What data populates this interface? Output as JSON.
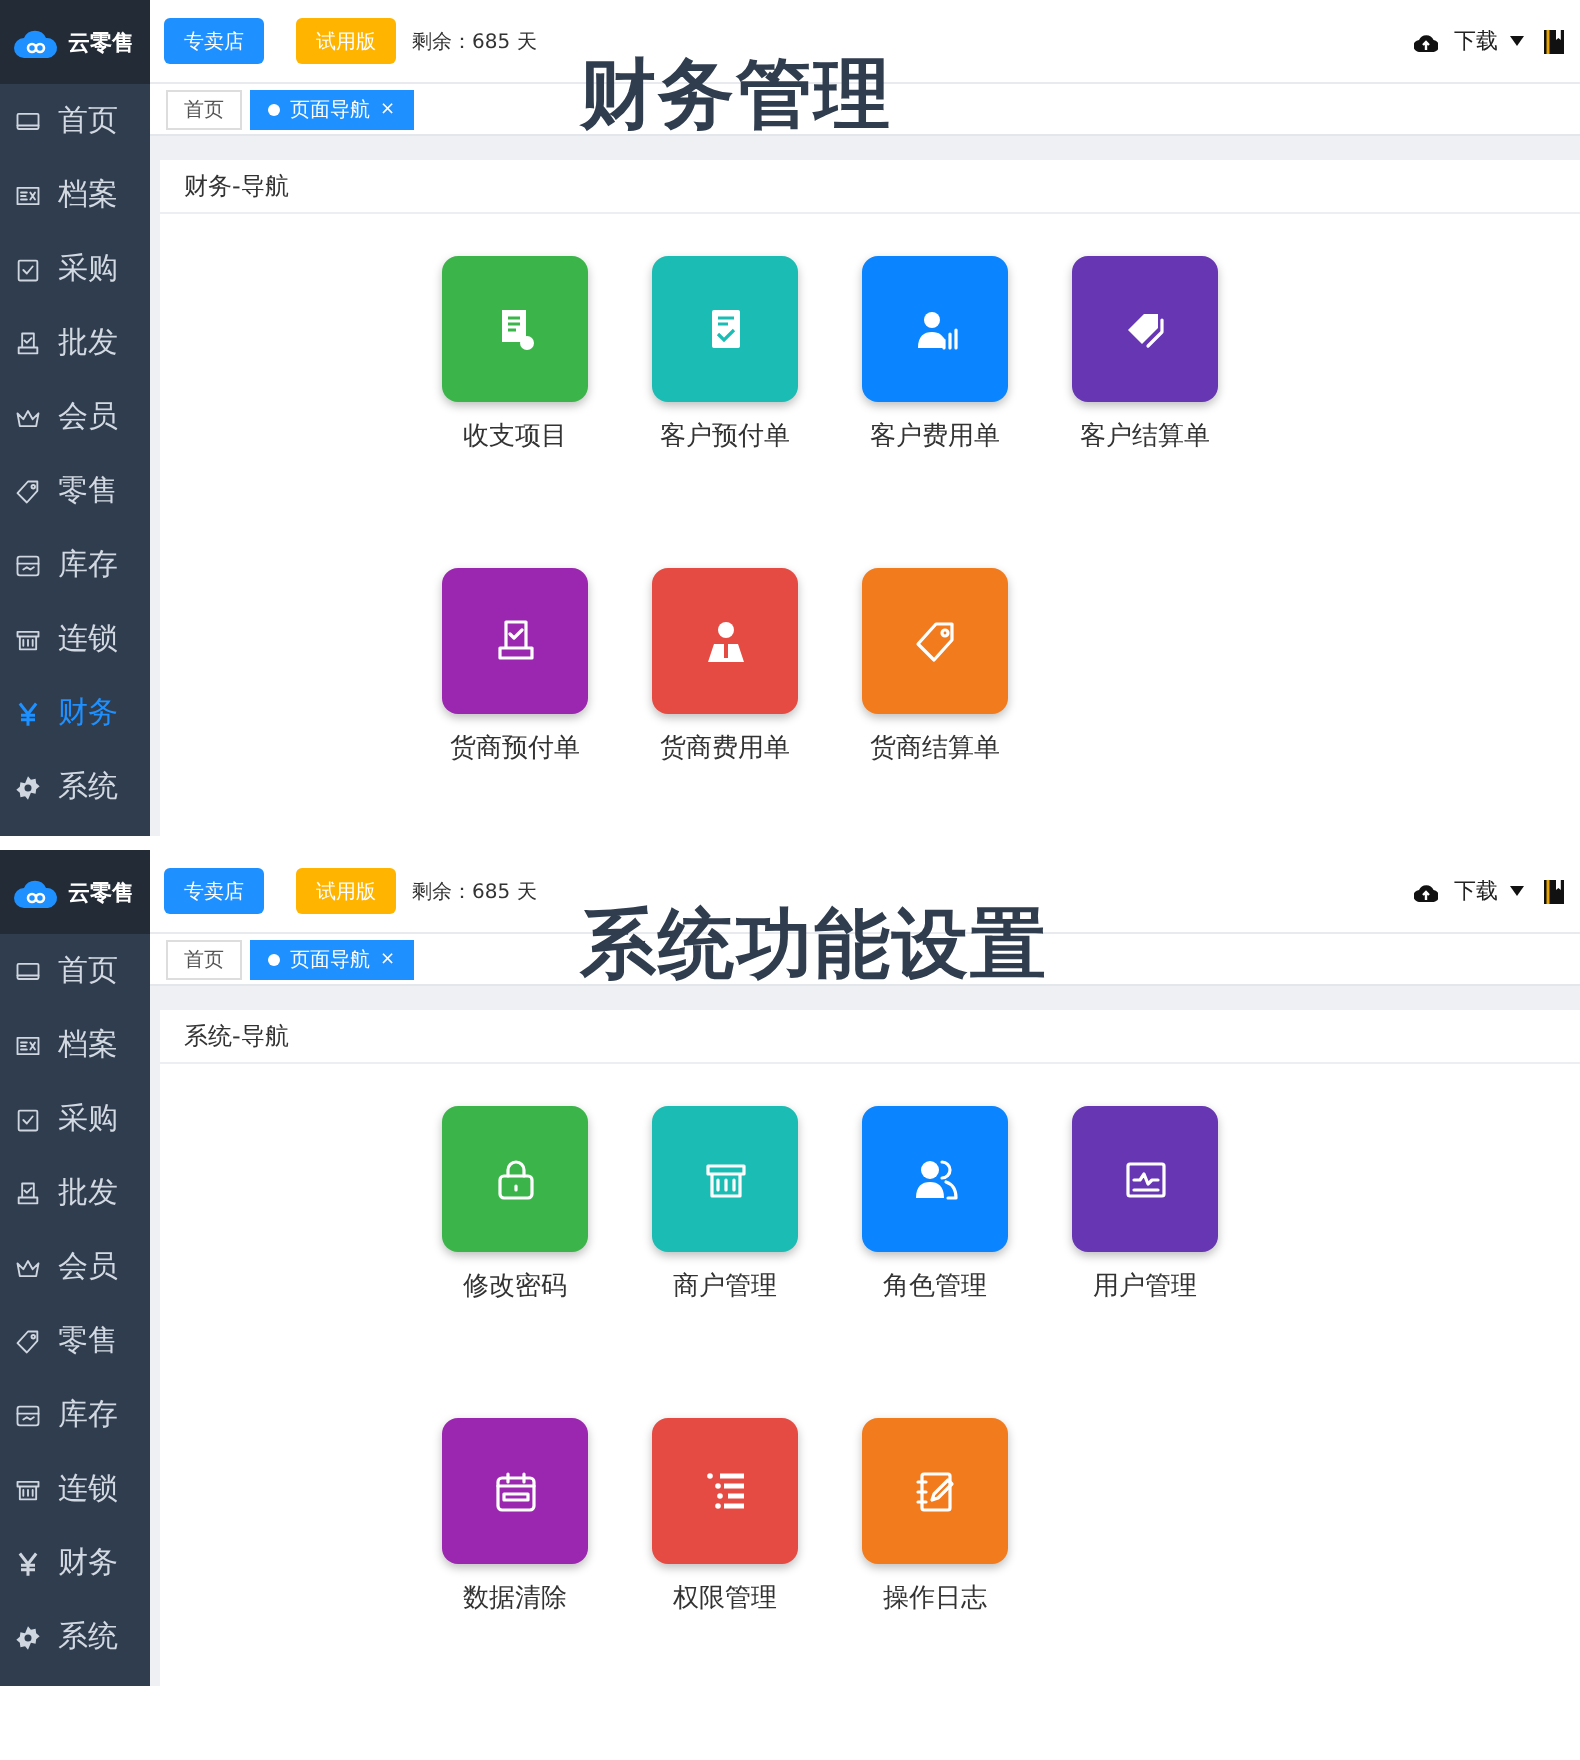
{
  "panels": [
    {
      "heading": "财务管理",
      "logo": "云零售",
      "store_button": "专卖店",
      "trial_button": "试用版",
      "remaining": "剩余：685 天",
      "download": "下载",
      "tabs": [
        {
          "label": "首页",
          "selected": false
        },
        {
          "label": "页面导航",
          "selected": true,
          "close": "×"
        }
      ],
      "menu": [
        {
          "label": "首页",
          "selected": false
        },
        {
          "label": "档案",
          "selected": false
        },
        {
          "label": "采购",
          "selected": false
        },
        {
          "label": "批发",
          "selected": false
        },
        {
          "label": "会员",
          "selected": false
        },
        {
          "label": "零售",
          "selected": false
        },
        {
          "label": "库存",
          "selected": false
        },
        {
          "label": "连锁",
          "selected": false
        },
        {
          "label": "财务",
          "selected": true
        },
        {
          "label": "系统",
          "selected": false
        }
      ],
      "section_title": "财务-导航",
      "tiles": [
        {
          "label": "收支项目",
          "color": "#3bb54a"
        },
        {
          "label": "客户预付单",
          "color": "#1bbcb3"
        },
        {
          "label": "客户费用单",
          "color": "#0a84ff"
        },
        {
          "label": "客户结算单",
          "color": "#6636b3"
        },
        {
          "label": "货商预付单",
          "color": "#9b27b0"
        },
        {
          "label": "货商费用单",
          "color": "#e54b43"
        },
        {
          "label": "货商结算单",
          "color": "#f27b1e"
        }
      ]
    },
    {
      "heading": "系统功能设置",
      "logo": "云零售",
      "store_button": "专卖店",
      "trial_button": "试用版",
      "remaining": "剩余：685 天",
      "download": "下载",
      "tabs": [
        {
          "label": "首页",
          "selected": false
        },
        {
          "label": "页面导航",
          "selected": true,
          "close": "×"
        }
      ],
      "menu": [
        {
          "label": "首页",
          "selected": false
        },
        {
          "label": "档案",
          "selected": false
        },
        {
          "label": "采购",
          "selected": false
        },
        {
          "label": "批发",
          "selected": false
        },
        {
          "label": "会员",
          "selected": false
        },
        {
          "label": "零售",
          "selected": false
        },
        {
          "label": "库存",
          "selected": false
        },
        {
          "label": "连锁",
          "selected": false
        },
        {
          "label": "财务",
          "selected": false
        },
        {
          "label": "系统",
          "selected": false
        }
      ],
      "section_title": "系统-导航",
      "tiles": [
        {
          "label": "修改密码",
          "color": "#3bb54a"
        },
        {
          "label": "商户管理",
          "color": "#1bbcb3"
        },
        {
          "label": "角色管理",
          "color": "#0a84ff"
        },
        {
          "label": "用户管理",
          "color": "#6636b3"
        },
        {
          "label": "数据清除",
          "color": "#9b27b0"
        },
        {
          "label": "权限管理",
          "color": "#e54b43"
        },
        {
          "label": "操作日志",
          "color": "#f27b1e"
        }
      ]
    }
  ]
}
